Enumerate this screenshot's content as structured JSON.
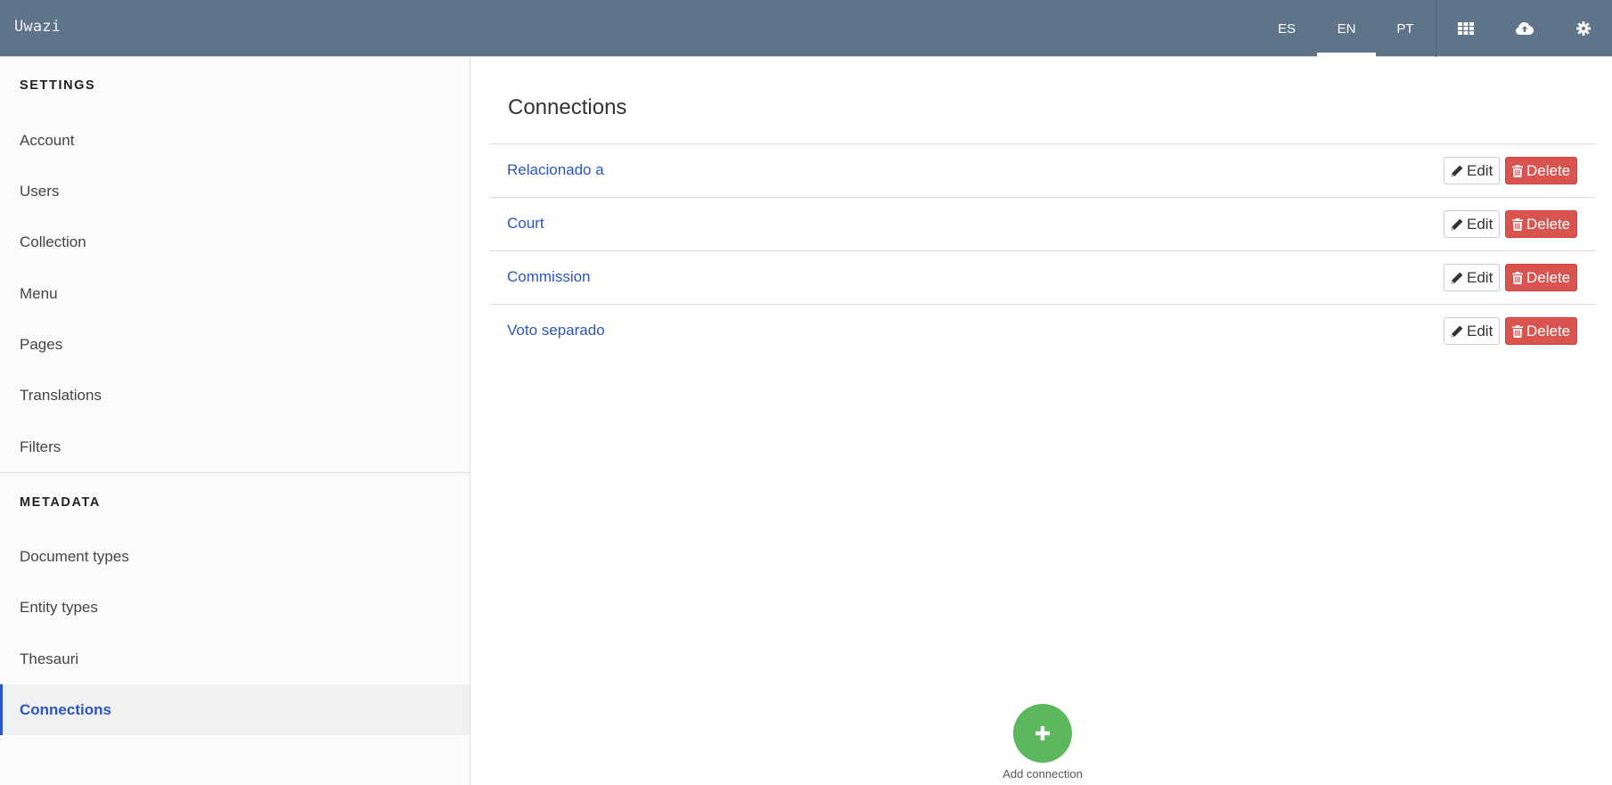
{
  "header": {
    "logo": "Uwazi",
    "languages": [
      {
        "code": "ES",
        "active": false
      },
      {
        "code": "EN",
        "active": true
      },
      {
        "code": "PT",
        "active": false
      }
    ],
    "icons": [
      "library-grid-icon",
      "cloud-upload-icon",
      "settings-gear-icon"
    ]
  },
  "sidebar": {
    "settings_title": "SETTINGS",
    "settings_items": [
      {
        "label": "Account"
      },
      {
        "label": "Users"
      },
      {
        "label": "Collection"
      },
      {
        "label": "Menu"
      },
      {
        "label": "Pages"
      },
      {
        "label": "Translations"
      },
      {
        "label": "Filters"
      }
    ],
    "metadata_title": "METADATA",
    "metadata_items": [
      {
        "label": "Document types"
      },
      {
        "label": "Entity types"
      },
      {
        "label": "Thesauri"
      },
      {
        "label": "Connections",
        "active": true
      }
    ]
  },
  "main": {
    "title": "Connections",
    "connections": [
      {
        "name": "Relacionado a"
      },
      {
        "name": "Court"
      },
      {
        "name": "Commission"
      },
      {
        "name": "Voto separado"
      }
    ],
    "edit_label": "Edit",
    "delete_label": "Delete",
    "add_label": "Add connection"
  },
  "colors": {
    "header_bg": "#5f7389",
    "link": "#2b56c1",
    "danger": "#d9534f",
    "success": "#5cb85c"
  }
}
